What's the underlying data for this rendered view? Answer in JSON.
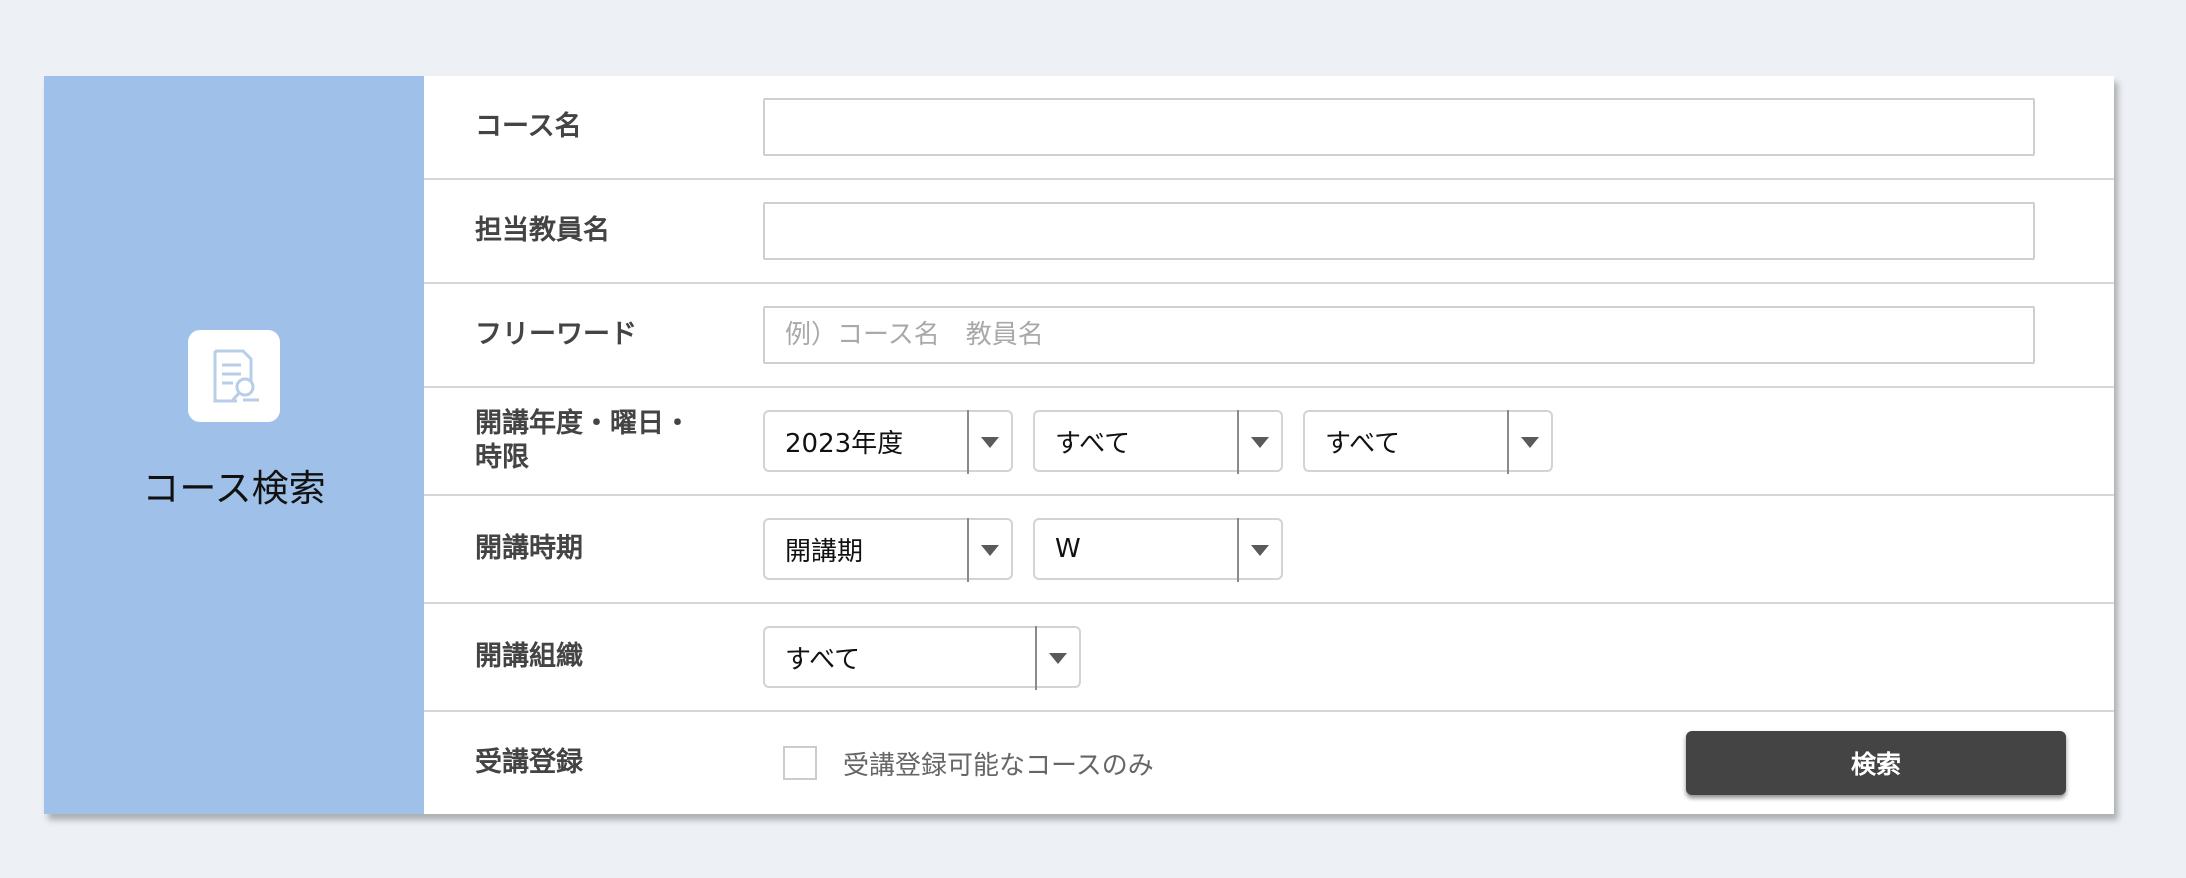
{
  "sidebar": {
    "title": "コース検索",
    "icon": "document-search-icon"
  },
  "fields": {
    "course_name": {
      "label": "コース名",
      "value": "",
      "placeholder": ""
    },
    "teacher_name": {
      "label": "担当教員名",
      "value": "",
      "placeholder": ""
    },
    "free_word": {
      "label": "フリーワード",
      "value": "",
      "placeholder": "例）コース名　教員名"
    },
    "year_day_period": {
      "label": "開講年度・曜日・時限",
      "year": "2023年度",
      "day": "すべて",
      "period": "すべて"
    },
    "term": {
      "label": "開講時期",
      "term_type": "開講期",
      "term_value": "W"
    },
    "organization": {
      "label": "開講組織",
      "value": "すべて"
    },
    "registration": {
      "label": "受講登録",
      "checkbox_label": "受講登録可能なコースのみ",
      "checked": false
    }
  },
  "actions": {
    "search_label": "検索"
  },
  "colors": {
    "sidebar_bg": "#9fc0e8",
    "page_bg": "#edf1f6",
    "button_bg": "#444444",
    "label_text": "#444444"
  }
}
